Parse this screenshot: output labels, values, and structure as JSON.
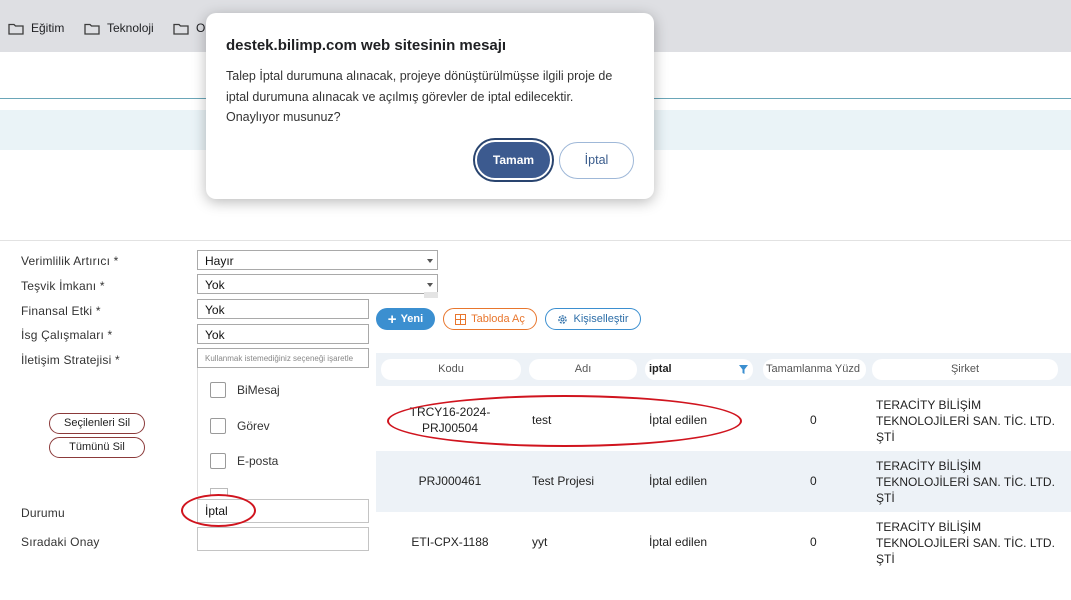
{
  "bookmarks": [
    {
      "label": "Eğitim",
      "icon": "folder-icon"
    },
    {
      "label": "Teknoloji",
      "icon": "folder-icon"
    },
    {
      "label": "O",
      "icon": "folder-icon"
    }
  ],
  "form": {
    "fields": [
      {
        "label": "Verimlilik Artırıcı *",
        "value": "Hayır"
      },
      {
        "label": "Teşvik İmkanı *",
        "value": "Yok"
      },
      {
        "label": "Finansal Etki *",
        "value": "Yok"
      },
      {
        "label": "İsg Çalışmaları *",
        "value": "Yok"
      },
      {
        "label": "İletişim Stratejisi *",
        "placeholder": "Kullanmak istemediğiniz seçeneği işaretle"
      }
    ],
    "remove_selected": "Seçilenleri Sil",
    "remove_all": "Tümünü Sil",
    "status_label": "Durumu",
    "status_value": "İptal",
    "next_approval_label": "Sıradaki Onay",
    "next_approval_value": ""
  },
  "dropdown": {
    "options": [
      "BiMesaj",
      "Görev",
      "E-posta"
    ]
  },
  "toolbar": {
    "new_label": "Yeni",
    "open_table_label": "Tabloda Aç",
    "customize_label": "Kişiselleştir"
  },
  "table": {
    "columns": [
      "Kodu",
      "Adı",
      "iptal",
      "Tamamlanma Yüzd",
      "Şirket"
    ],
    "rows": [
      {
        "kod": [
          "TRCY16-2024-",
          "PRJ00504"
        ],
        "ad": "test",
        "durum": "İptal edilen",
        "yuzde": "0",
        "sirket": [
          "TERACİTY BİLİŞİM",
          "TEKNOLOJİLERİ SAN. TİC. LTD.",
          "ŞTİ"
        ]
      },
      {
        "kod": [
          "PRJ000461"
        ],
        "ad": "Test Projesi",
        "durum": "İptal edilen",
        "yuzde": "0",
        "sirket": [
          "TERACİTY BİLİŞİM",
          "TEKNOLOJİLERİ SAN. TİC. LTD.",
          "ŞTİ"
        ]
      },
      {
        "kod": [
          "ETI-CPX-1188"
        ],
        "ad": "yyt",
        "durum": "İptal edilen",
        "yuzde": "0",
        "sirket": [
          "TERACİTY BİLİŞİM",
          "TEKNOLOJİLERİ SAN. TİC. LTD.",
          "ŞTİ"
        ]
      }
    ]
  },
  "dialog": {
    "title": "destek.bilimp.com web sitesinin mesajı",
    "message_lines": [
      "Talep İptal durumuna alınacak, projeye dönüştürülmüşse ilgili proje de",
      "iptal durumuna alınacak ve açılmış görevler de iptal edilecektir.",
      "Onaylıyor musunuz?"
    ],
    "ok_label": "Tamam",
    "cancel_label": "İptal"
  },
  "colors": {
    "accent": "#3c5a8f",
    "annotation": "#d0141e",
    "toolbar_blue": "#3b8fd0",
    "toolbar_orange": "#e8762d"
  }
}
